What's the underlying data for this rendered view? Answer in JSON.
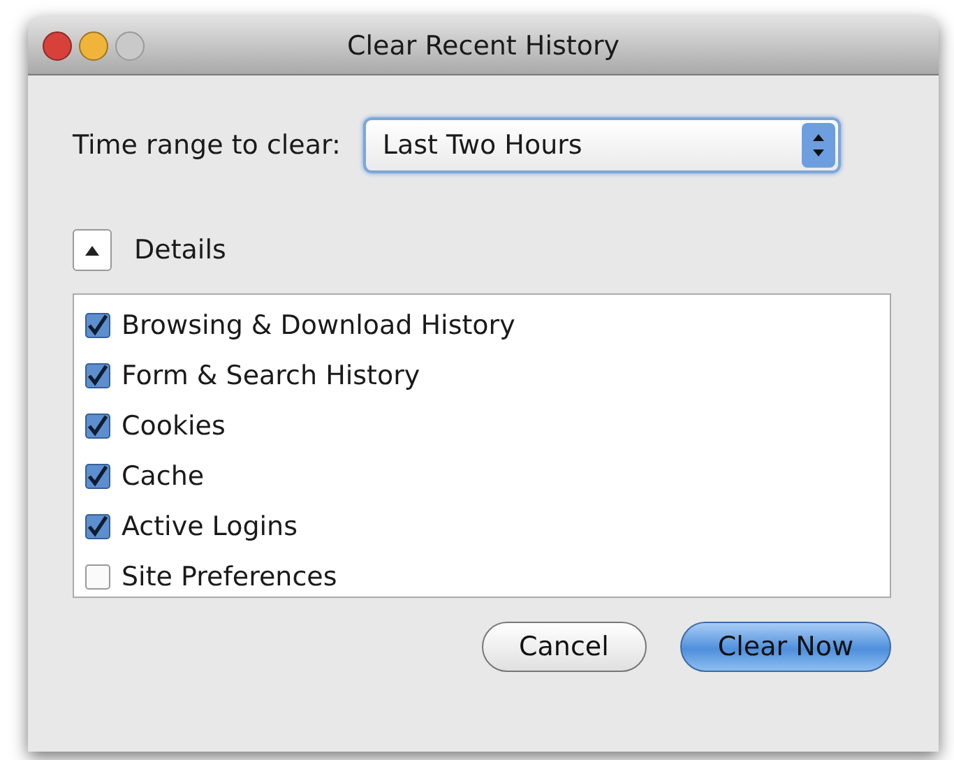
{
  "window": {
    "title": "Clear Recent History"
  },
  "time_range": {
    "label": "Time range to clear:",
    "value": "Last Two Hours"
  },
  "details": {
    "label": "Details",
    "expanded": true
  },
  "items": [
    {
      "label": "Browsing & Download History",
      "checked": true
    },
    {
      "label": "Form & Search History",
      "checked": true
    },
    {
      "label": "Cookies",
      "checked": true
    },
    {
      "label": "Cache",
      "checked": true
    },
    {
      "label": "Active Logins",
      "checked": true
    },
    {
      "label": "Site Preferences",
      "checked": false
    }
  ],
  "buttons": [
    {
      "label": "Cancel",
      "default": false
    },
    {
      "label": "Clear Now",
      "default": true
    }
  ]
}
